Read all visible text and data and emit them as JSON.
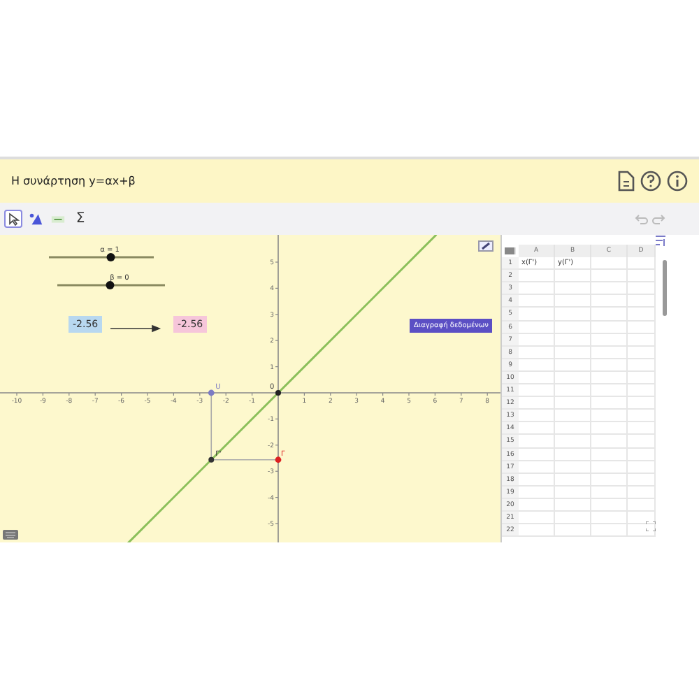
{
  "header": {
    "title": "Η συνάρτηση y=αx+β",
    "icons": [
      {
        "kind": "document"
      },
      {
        "kind": "help"
      },
      {
        "kind": "info"
      }
    ]
  },
  "toolbar": {
    "tools": [
      {
        "kind": "move",
        "selected": true
      },
      {
        "kind": "slider",
        "selected": false
      },
      {
        "kind": "input",
        "selected": false
      },
      {
        "kind": "sum",
        "label": "Σ",
        "selected": false
      }
    ]
  },
  "graphics": {
    "sliders": [
      {
        "label": "α = 1",
        "level": 0.59
      },
      {
        "label": "β = 0",
        "level": 0.49
      }
    ],
    "values": [
      {
        "text": "-2.56",
        "color": "#b8d8f0"
      },
      {
        "text": "-2.56",
        "color": "#f6c6da"
      }
    ],
    "button": "Διαγραφή δεδομένων",
    "x_tick_labels": [
      "-10",
      "-9",
      "-8",
      "-7",
      "-6",
      "-5",
      "-4",
      "-3",
      "-2",
      "-1",
      "1",
      "2",
      "3",
      "4",
      "5",
      "6",
      "7",
      "8"
    ],
    "y_tick_labels": [
      "5",
      "4",
      "3",
      "2",
      "1",
      "-1",
      "-2",
      "-3",
      "-4",
      "-5"
    ],
    "origin_label": "0",
    "points": [
      {
        "label": "U",
        "color": "#7b7bc4"
      },
      {
        "label": "Γ'",
        "color": "#333333"
      },
      {
        "label": "Γ",
        "color": "#dd2222"
      }
    ]
  },
  "spreadsheet": {
    "columns": [
      "A",
      "B",
      "C",
      "D"
    ],
    "rows": [
      {
        "number": "1",
        "cells": [
          "x(Γ')",
          "y(Γ')"
        ]
      },
      {
        "number": "2"
      },
      {
        "number": "3"
      },
      {
        "number": "4"
      },
      {
        "number": "5"
      },
      {
        "number": "6"
      },
      {
        "number": "7"
      },
      {
        "number": "8"
      },
      {
        "number": "9"
      },
      {
        "number": "10"
      },
      {
        "number": "11"
      },
      {
        "number": "12"
      },
      {
        "number": "13"
      },
      {
        "number": "14"
      },
      {
        "number": "15"
      },
      {
        "number": "16"
      },
      {
        "number": "17"
      },
      {
        "number": "18"
      },
      {
        "number": "19"
      },
      {
        "number": "20"
      },
      {
        "number": "21"
      },
      {
        "number": "22"
      }
    ]
  }
}
